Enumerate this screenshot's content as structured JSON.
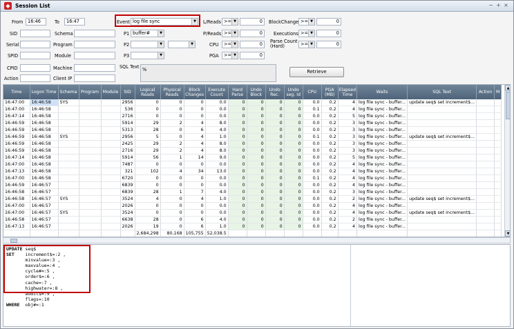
{
  "window": {
    "title": "Session List",
    "controls": [
      "−",
      "+",
      "×"
    ]
  },
  "filters": {
    "from_label": "From",
    "from_value": "16:46",
    "to_label": "To",
    "to_value": "16:47",
    "sid_label": "SID",
    "serial_label": "Serial",
    "spid_label": "SPID",
    "cpid_label": "CPID",
    "action_label": "Action",
    "schema_label": "Schema",
    "program_label": "Program",
    "module_label": "Module",
    "machine_label": "Machine",
    "clientip_label": "Client IP",
    "event_label": "Event",
    "event_value": "log file sync",
    "p1_label": "P1",
    "p1_value": "buffer#",
    "p2_label": "P2",
    "p3_label": "P3",
    "sqltext_label": "SQL Text",
    "sqltext_value": "%",
    "lreads_label": "L/Reads",
    "preads_label": "P/Reads",
    "cpu_label": "CPU",
    "pga_label": "PGA",
    "op": ">=",
    "zero": "0",
    "blockchanges_label": "BlockChanges",
    "executions_label": "Executions",
    "parsecount_label": "Parse Count (Hard)",
    "retrieve_label": "Retrieve"
  },
  "grid": {
    "columns": [
      "Time",
      "Logon Time",
      "Schema",
      "Program",
      "Module",
      "SID",
      "Logical Reads",
      "Physical Reads",
      "Block Changes",
      "Execute Count",
      "Hard Parse",
      "Undo Block",
      "Undo Rec.",
      "Undo seg. Id",
      "CPU",
      "PGA (MB)",
      "Elapsed Time",
      "Waits",
      "SQL Text",
      "Action",
      "M"
    ],
    "rows": [
      [
        "16:47:00",
        "16:46:58",
        "SYS",
        "",
        "",
        "2956",
        "0",
        "0",
        "0",
        "0.0",
        "0",
        "0",
        "0",
        "0",
        "0.0",
        "0.2",
        "4",
        "log file sync - buffer...",
        "update seq$ set increment$..."
      ],
      [
        "16:47:00",
        "16:46:58",
        "",
        "",
        "",
        "536",
        "0",
        "0",
        "0",
        "0.0",
        "0",
        "0",
        "0",
        "0",
        "0.1",
        "0.2",
        "4",
        "log file sync - buffer...",
        ""
      ],
      [
        "16:47:14",
        "16:46:58",
        "",
        "",
        "",
        "2716",
        "0",
        "0",
        "0",
        "0.0",
        "0",
        "0",
        "0",
        "0",
        "0.0",
        "0.2",
        "5",
        "log file sync - buffer...",
        ""
      ],
      [
        "16:46:59",
        "16:46:58",
        "",
        "",
        "",
        "5914",
        "29",
        "2",
        "4",
        "8.0",
        "0",
        "0",
        "0",
        "0",
        "0.0",
        "0.2",
        "3",
        "log file sync - buffer...",
        ""
      ],
      [
        "16:46:59",
        "16:46:58",
        "",
        "",
        "",
        "5313",
        "28",
        "0",
        "6",
        "4.0",
        "0",
        "0",
        "0",
        "0",
        "0.0",
        "0.2",
        "3",
        "log file sync - buffer...",
        ""
      ],
      [
        "16:46:59",
        "16:46:58",
        "SYS",
        "",
        "",
        "2956",
        "5",
        "0",
        "4",
        "1.0",
        "0",
        "0",
        "0",
        "0",
        "0.1",
        "0.2",
        "3",
        "log file sync - buffer...",
        "update seq$ set increment$..."
      ],
      [
        "16:46:59",
        "16:46:58",
        "",
        "",
        "",
        "2425",
        "29",
        "2",
        "4",
        "8.0",
        "0",
        "0",
        "0",
        "0",
        "0.0",
        "0.2",
        "3",
        "log file sync - buffer...",
        ""
      ],
      [
        "16:46:59",
        "16:46:58",
        "",
        "",
        "",
        "2716",
        "29",
        "2",
        "4",
        "8.0",
        "0",
        "0",
        "0",
        "0",
        "0.0",
        "0.2",
        "3",
        "log file sync - buffer...",
        ""
      ],
      [
        "16:47:14",
        "16:46:58",
        "",
        "",
        "",
        "5914",
        "56",
        "1",
        "14",
        "9.0",
        "0",
        "0",
        "0",
        "0",
        "0.0",
        "0.2",
        "5",
        "log file sync - buffer...",
        ""
      ],
      [
        "16:47:00",
        "16:46:58",
        "",
        "",
        "",
        "7487",
        "0",
        "0",
        "0",
        "0.0",
        "0",
        "0",
        "0",
        "0",
        "0.0",
        "0.2",
        "4",
        "log file sync - buffer...",
        ""
      ],
      [
        "16:47:13",
        "16:46:58",
        "",
        "",
        "",
        "321",
        "102",
        "4",
        "34",
        "13.0",
        "0",
        "0",
        "0",
        "0",
        "0.0",
        "0.2",
        "4",
        "log file sync - buffer...",
        ""
      ],
      [
        "16:47:00",
        "16:46:58",
        "",
        "",
        "",
        "6720",
        "0",
        "0",
        "0",
        "0.0",
        "0",
        "0",
        "0",
        "0",
        "0.1",
        "0.2",
        "4",
        "log file sync - buffer...",
        ""
      ],
      [
        "16:46:59",
        "16:46:57",
        "",
        "",
        "",
        "6839",
        "0",
        "0",
        "0",
        "0.0",
        "0",
        "0",
        "0",
        "0",
        "0.0",
        "0.2",
        "4",
        "log file sync - buffer...",
        ""
      ],
      [
        "16:46:58",
        "16:46:57",
        "",
        "",
        "",
        "6839",
        "28",
        "1",
        "7",
        "4.0",
        "0",
        "0",
        "0",
        "0",
        "0.0",
        "0.2",
        "3",
        "log file sync - buffer...",
        ""
      ],
      [
        "16:46:58",
        "16:46:57",
        "SYS",
        "",
        "",
        "3524",
        "4",
        "0",
        "4",
        "1.0",
        "0",
        "0",
        "0",
        "0",
        "0.0",
        "0.2",
        "2",
        "log file sync - buffer...",
        "update seq$ set increment$..."
      ],
      [
        "16:47:00",
        "16:46:57",
        "",
        "",
        "",
        "2026",
        "0",
        "0",
        "0",
        "0.0",
        "0",
        "0",
        "0",
        "0",
        "0.0",
        "0.2",
        "4",
        "log file sync - buffer...",
        ""
      ],
      [
        "16:47:00",
        "16:46:57",
        "SYS",
        "",
        "",
        "3524",
        "0",
        "0",
        "0",
        "0.0",
        "0",
        "0",
        "0",
        "0",
        "0.0",
        "0.2",
        "4",
        "log file sync - buffer...",
        "update seq$ set increment$..."
      ],
      [
        "16:46:58",
        "16:46:57",
        "",
        "",
        "",
        "6638",
        "28",
        "0",
        "6",
        "4.0",
        "0",
        "0",
        "0",
        "0",
        "0.0",
        "0.2",
        "2",
        "log file sync - buffer...",
        ""
      ],
      [
        "16:47:13",
        "16:46:57",
        "",
        "",
        "",
        "2026",
        "19",
        "0",
        "6",
        "1.0",
        "0",
        "0",
        "0",
        "0",
        "0.0",
        "0.2",
        "4",
        "log file sync - buffer...",
        ""
      ]
    ],
    "totals": {
      "logical_reads": "2,684,298",
      "physical_reads": "80,168",
      "block_changes": "105,755",
      "execute_count": "52,038.5"
    }
  },
  "sql_pane": {
    "lines": [
      {
        "kw": "UPDATE",
        "text": "seq$"
      },
      {
        "kw": "SET",
        "text": "increment$=:2 ,"
      },
      {
        "kw": "",
        "text": "minvalue=:3 ,"
      },
      {
        "kw": "",
        "text": "maxvalue=:4 ,"
      },
      {
        "kw": "",
        "text": "cycle#=:5 ,"
      },
      {
        "kw": "",
        "text": "order$=:6 ,"
      },
      {
        "kw": "",
        "text": "cache=:7 ,"
      },
      {
        "kw": "",
        "text": "highwater=:8 ,"
      },
      {
        "kw": "",
        "text": "audit$=:9 ,"
      },
      {
        "kw": "",
        "text": "flags=:10"
      },
      {
        "kw": "WHERE",
        "text": "obj#=:1"
      }
    ]
  },
  "colors": {
    "highlight": "#c00000",
    "header": "#5a6f85",
    "totals": "#ffff66"
  }
}
